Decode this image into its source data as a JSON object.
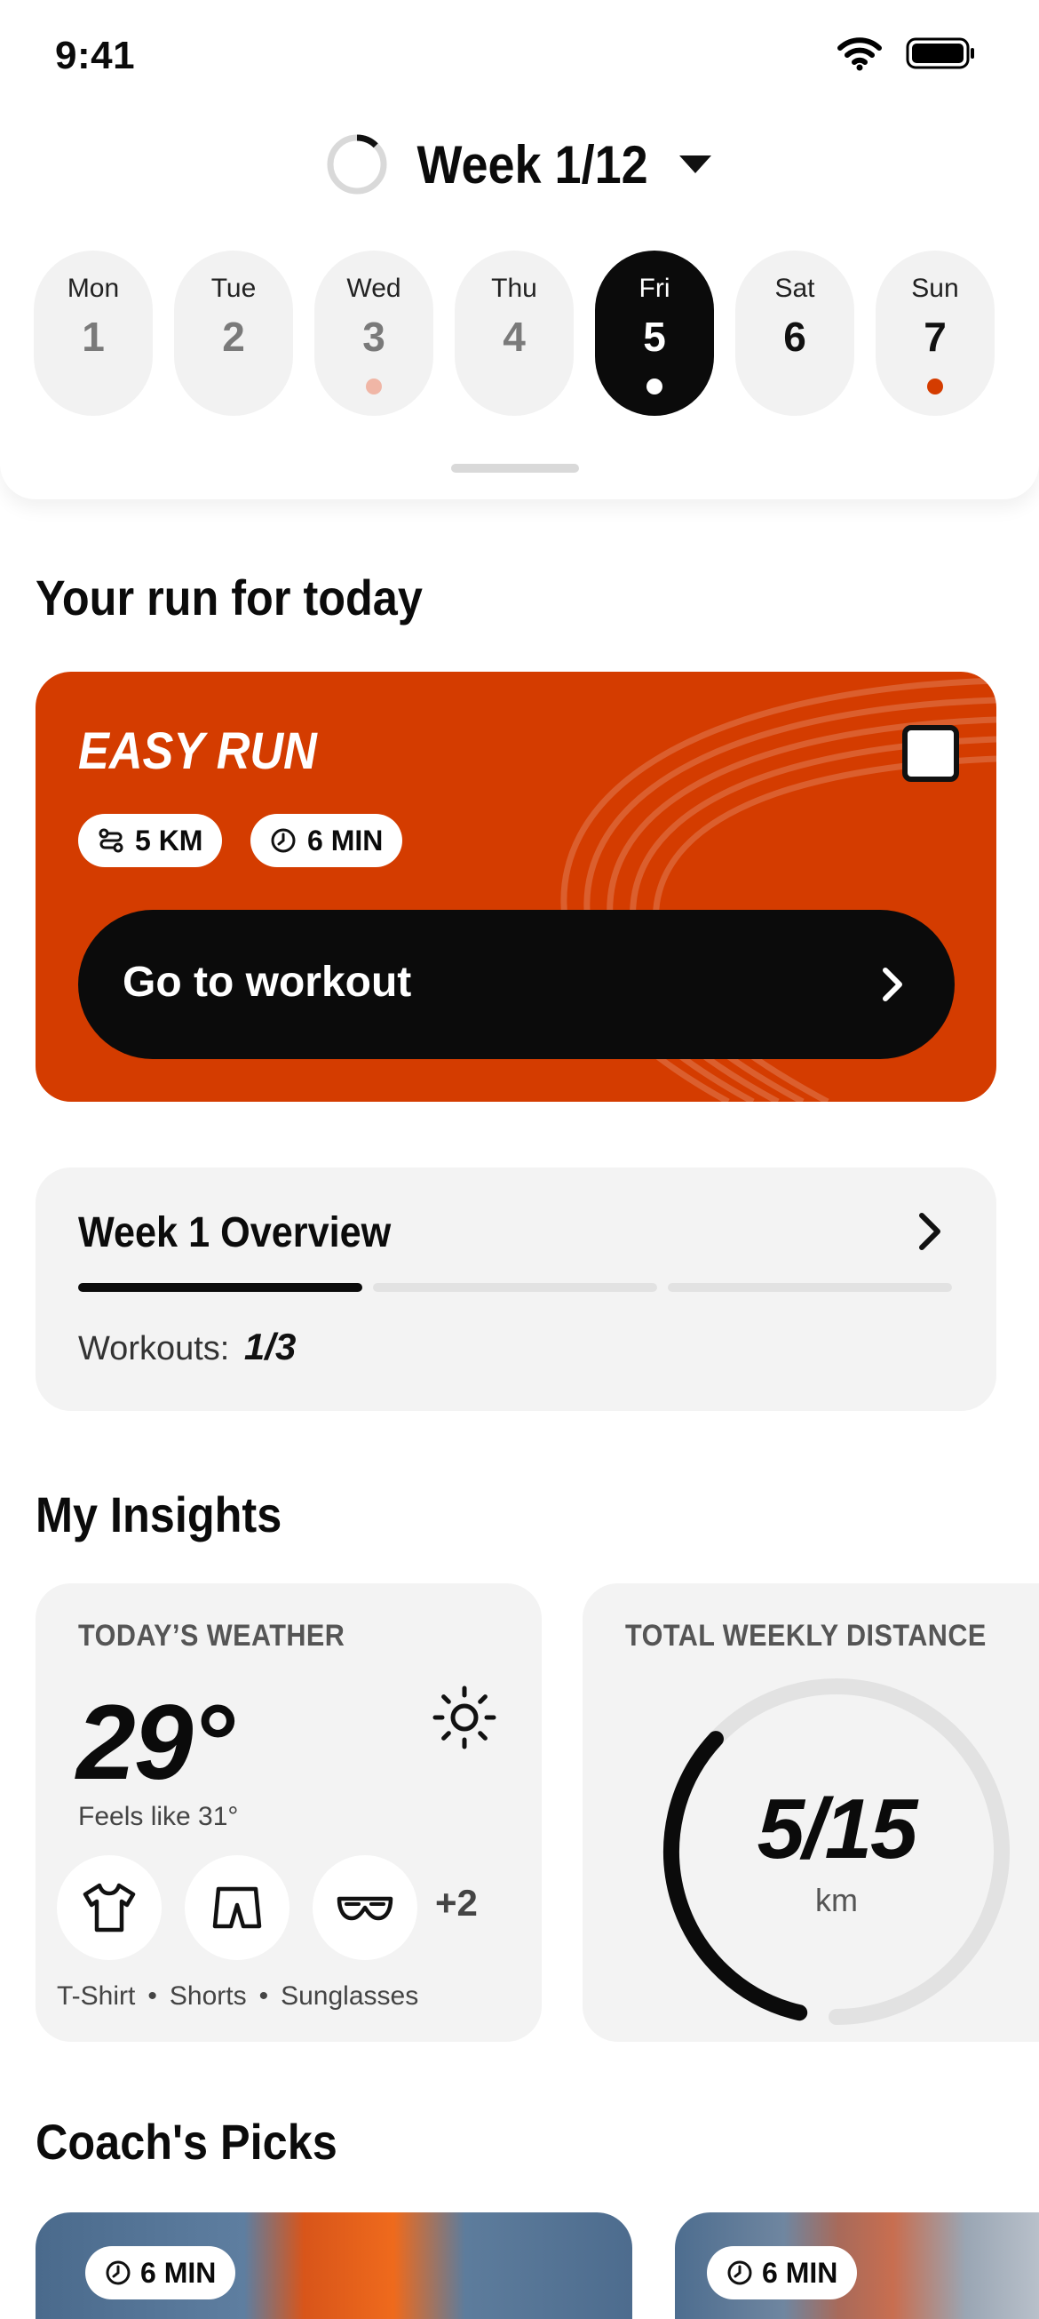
{
  "status_bar": {
    "time": "9:41"
  },
  "week": {
    "title": "Week 1/12"
  },
  "days": [
    {
      "name": "Mon",
      "num": "1"
    },
    {
      "name": "Tue",
      "num": "2"
    },
    {
      "name": "Wed",
      "num": "3"
    },
    {
      "name": "Thu",
      "num": "4"
    },
    {
      "name": "Fri",
      "num": "5"
    },
    {
      "name": "Sat",
      "num": "6"
    },
    {
      "name": "Sun",
      "num": "7"
    }
  ],
  "today": {
    "heading": "Your run for today",
    "workout_title": "EASY RUN",
    "distance": "5 KM",
    "duration": "6 MIN",
    "cta": "Go to workout"
  },
  "overview": {
    "title": "Week 1 Overview",
    "workouts_label": "Workouts:",
    "workouts_value": "1/3",
    "progress_fraction": 0.333
  },
  "insights": {
    "heading": "My Insights",
    "weather": {
      "label": "TODAY’S WEATHER",
      "temp": "29°",
      "feels": "Feels like 31°",
      "more": "+2",
      "gear": [
        "T-Shirt",
        "Shorts",
        "Sunglasses"
      ],
      "sep": "•"
    },
    "distance": {
      "label": "TOTAL WEEKLY DISTANCE",
      "value": "5/15",
      "unit": "km",
      "progress_fraction": 0.333
    }
  },
  "coach_picks": {
    "heading": "Coach's Picks",
    "items": [
      {
        "duration": "6 MIN"
      },
      {
        "duration": "6 MIN"
      }
    ]
  },
  "colors": {
    "accent": "#d43c00",
    "dark": "#0b0b0b",
    "card": "#f3f3f3"
  }
}
